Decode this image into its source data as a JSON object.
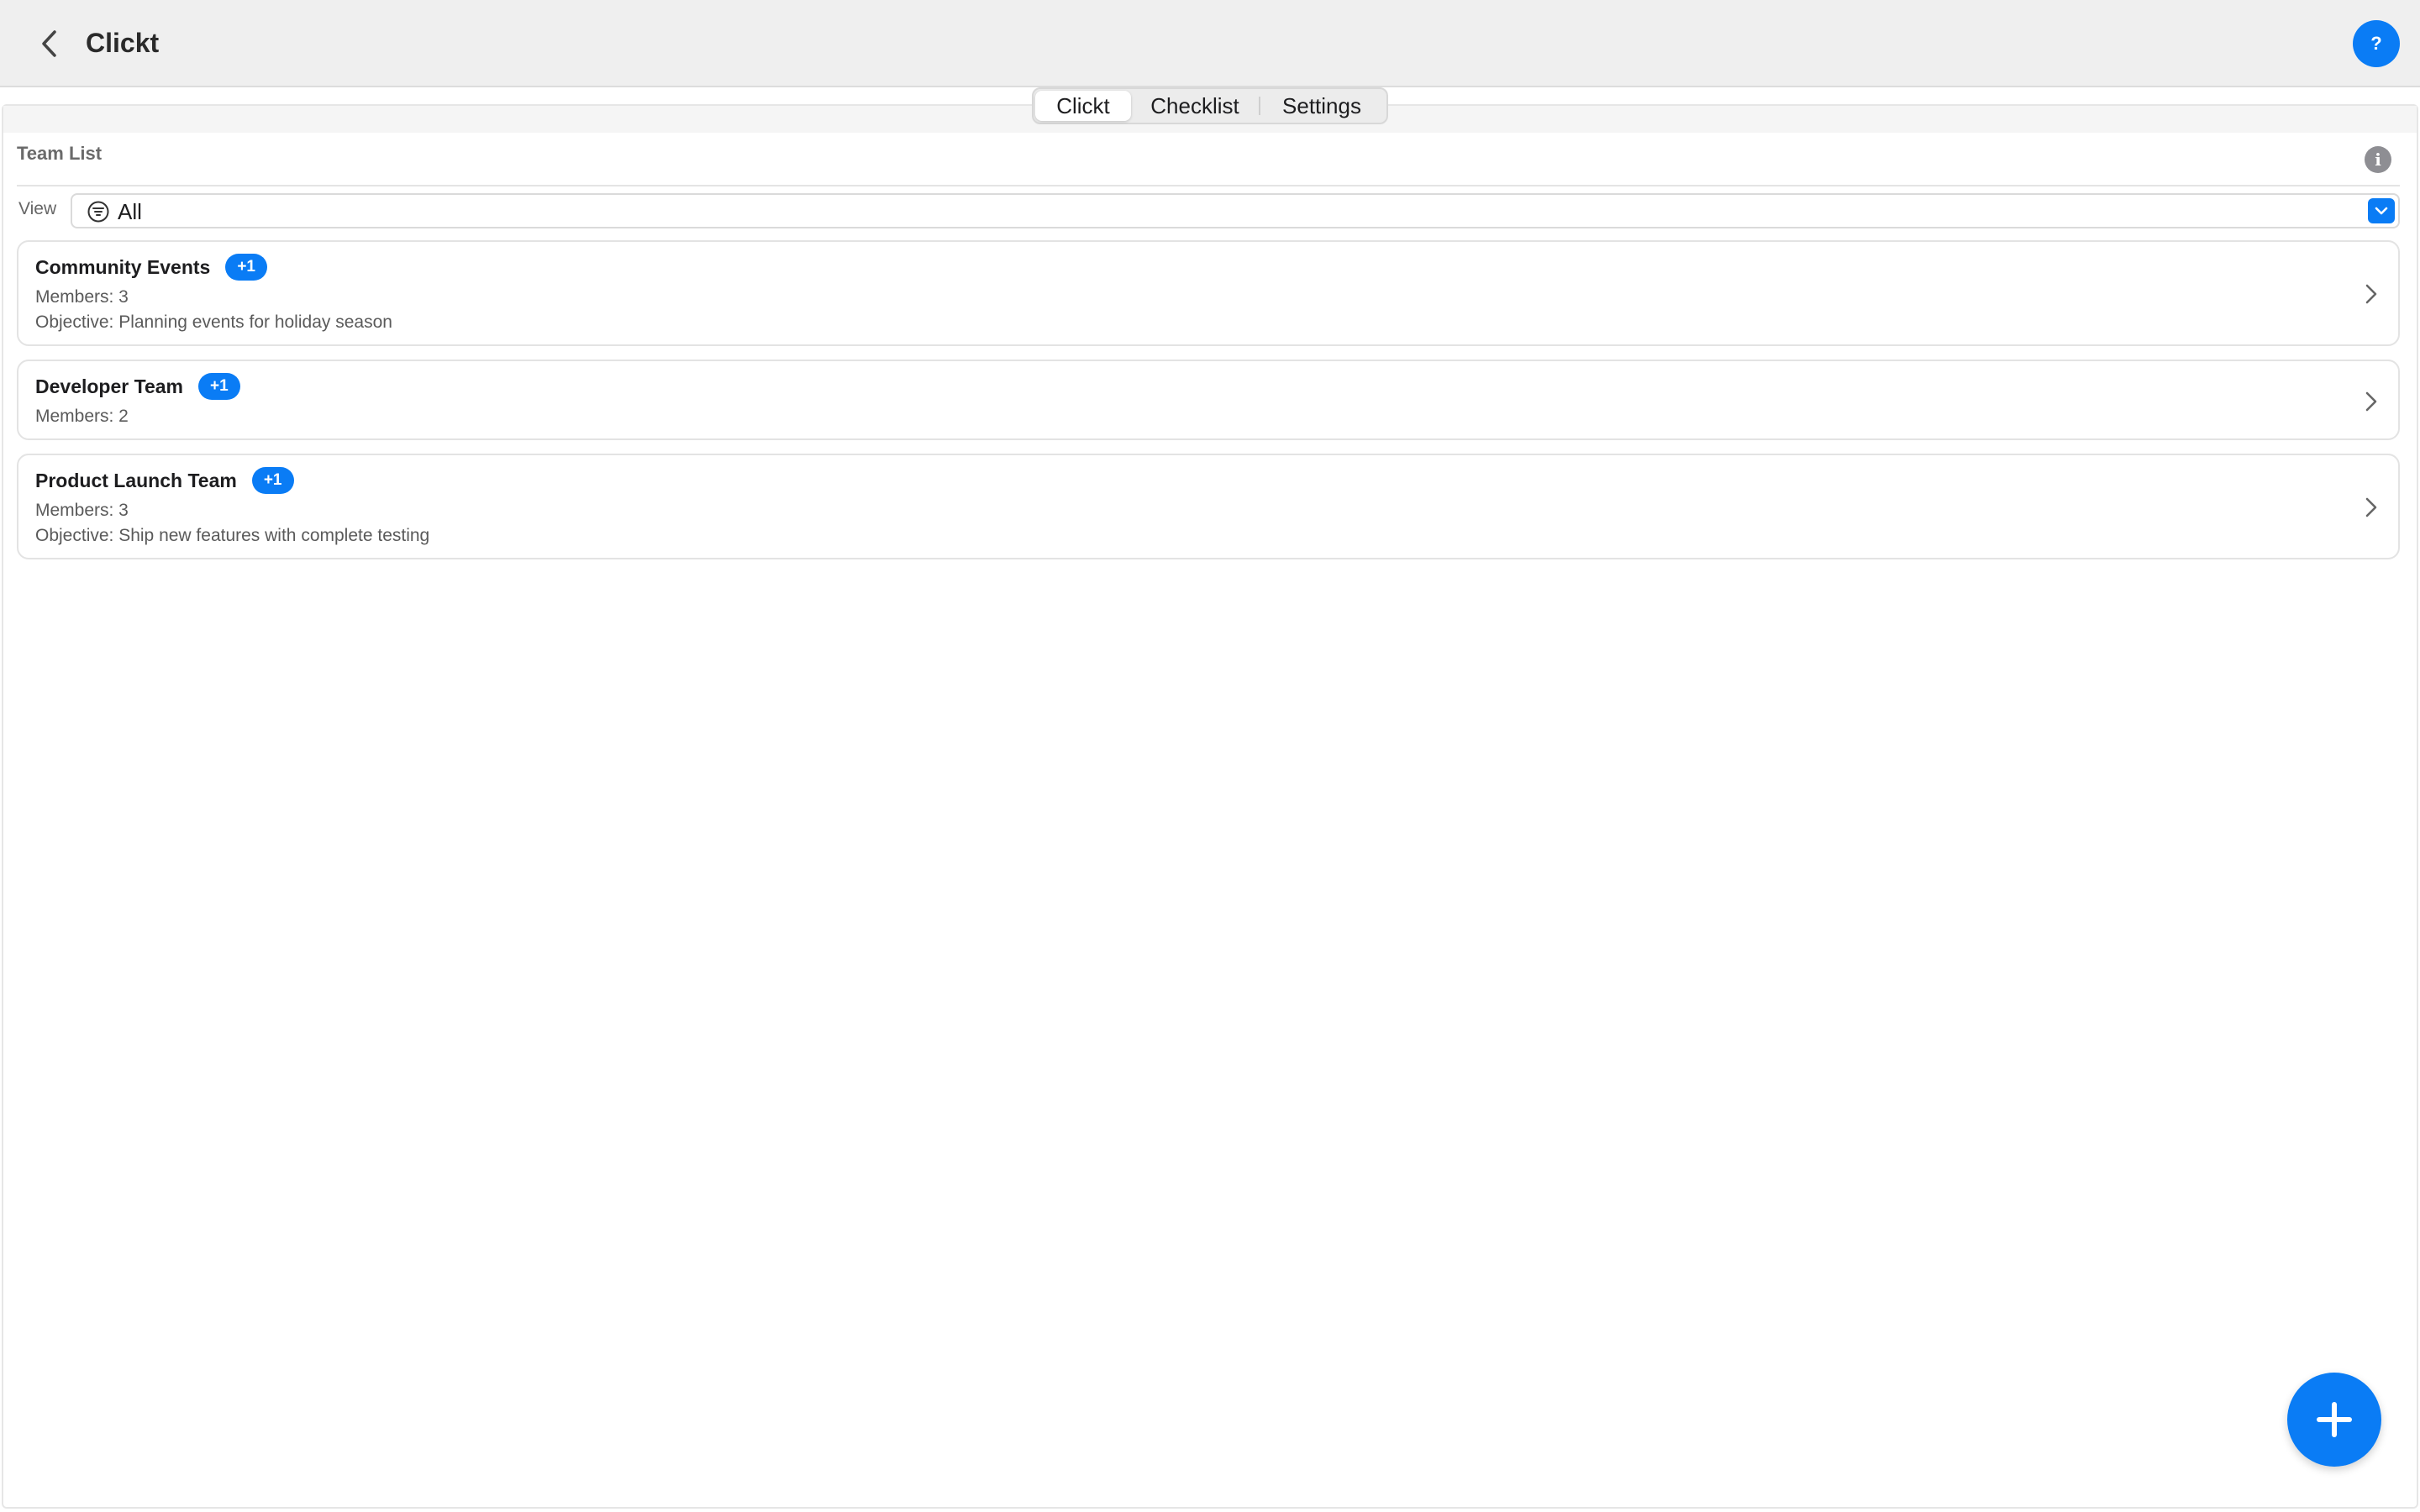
{
  "app": {
    "title": "Clickt",
    "help_label": "?"
  },
  "tabs": [
    {
      "label": "Clickt",
      "active": true
    },
    {
      "label": "Checklist",
      "active": false
    },
    {
      "label": "Settings",
      "active": false
    }
  ],
  "team_list": {
    "header": "Team List",
    "info_label": "i",
    "view_label": "View",
    "view_value": "All",
    "teams": [
      {
        "name": "Community Events",
        "badge": "+1",
        "members": "Members: 3",
        "objective": "Objective: Planning events for holiday season"
      },
      {
        "name": "Developer Team",
        "badge": "+1",
        "members": "Members: 2",
        "objective": ""
      },
      {
        "name": "Product Launch Team",
        "badge": "+1",
        "members": "Members: 3",
        "objective": "Objective: Ship new features with complete testing"
      }
    ]
  },
  "colors": {
    "accent": "#0a7cf5",
    "topbar_bg": "#efefef",
    "card_border": "#e3e3e3"
  },
  "icons": {
    "back": "chevron-left-icon",
    "help": "question-mark-icon",
    "info": "info-icon",
    "filter": "filter-icon",
    "dropdown": "chevron-down-icon",
    "row": "chevron-right-icon",
    "add": "plus-icon"
  }
}
